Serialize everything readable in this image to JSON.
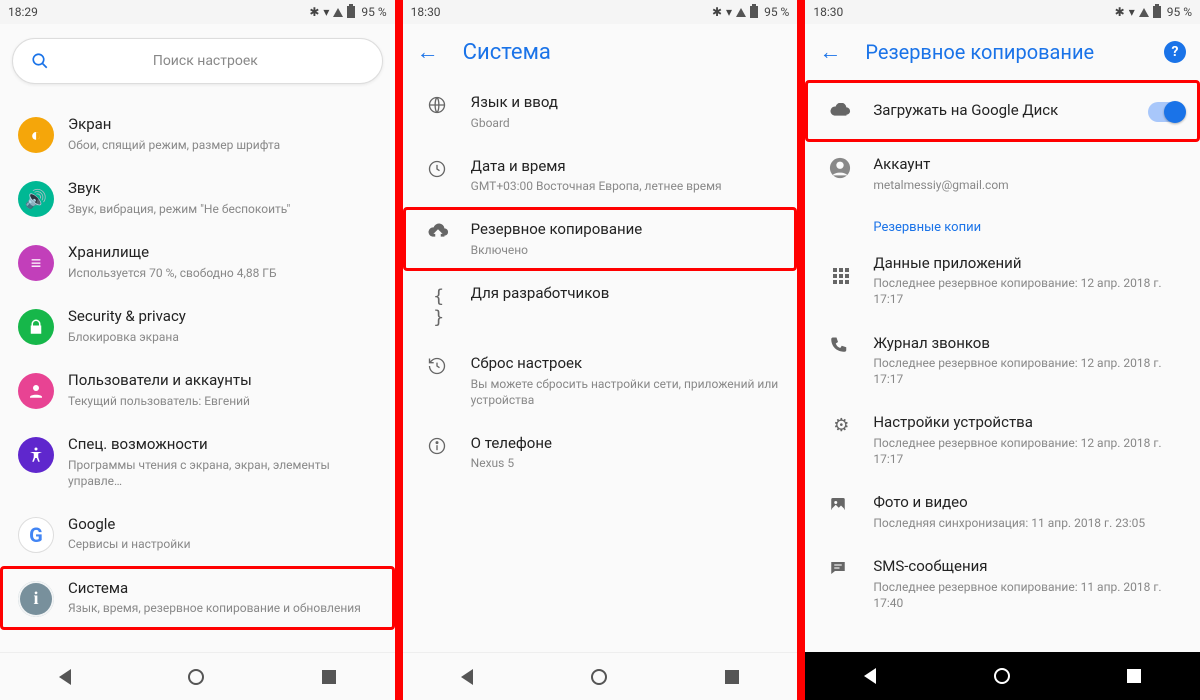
{
  "status": {
    "battery_text": "95 %"
  },
  "screen1": {
    "time": "18:29",
    "search_placeholder": "Поиск настроек",
    "items": [
      {
        "title": "Экран",
        "sub": "Обои, спящий режим, размер шрифта",
        "color": "#f5a60a"
      },
      {
        "title": "Звук",
        "sub": "Звук, вибрация, режим \"Не беспокоить\"",
        "color": "#00b894"
      },
      {
        "title": "Хранилище",
        "sub": "Используется 70 %, свободно 4,88 ГБ",
        "color": "#c23fba"
      },
      {
        "title": "Security & privacy",
        "sub": "Блокировка экрана",
        "color": "#16b74a"
      },
      {
        "title": "Пользователи и аккаунты",
        "sub": "Текущий пользователь: Евгений",
        "color": "#e84393"
      },
      {
        "title": "Спец. возможности",
        "sub": "Программы чтения с экрана, экран, элементы управле…",
        "color": "#5f27cd"
      },
      {
        "title": "Google",
        "sub": "Сервисы и настройки",
        "color": "#ffffff"
      },
      {
        "title": "Система",
        "sub": "Язык, время, резервное копирование и обновления",
        "color": "#78909c"
      }
    ]
  },
  "screen2": {
    "time": "18:30",
    "title": "Система",
    "items": [
      {
        "title": "Язык и ввод",
        "sub": "Gboard"
      },
      {
        "title": "Дата и время",
        "sub": "GMT+03:00 Восточная Европа, летнее время"
      },
      {
        "title": "Резервное копирование",
        "sub": "Включено"
      },
      {
        "title": "Для разработчиков",
        "sub": ""
      },
      {
        "title": "Сброс настроек",
        "sub": "Вы можете сбросить настройки сети, приложений или устройства"
      },
      {
        "title": "О телефоне",
        "sub": "Nexus 5"
      }
    ]
  },
  "screen3": {
    "time": "18:30",
    "title": "Резервное копирование",
    "upload": {
      "title": "Загружать на Google Диск"
    },
    "account": {
      "title": "Аккаунт",
      "sub": "metalmessiy@gmail.com"
    },
    "section_header": "Резервные копии",
    "items": [
      {
        "title": "Данные приложений",
        "sub": "Последнее резервное копирование: 12 апр. 2018 г. 17:17"
      },
      {
        "title": "Журнал звонков",
        "sub": "Последнее резервное копирование: 12 апр. 2018 г. 17:17"
      },
      {
        "title": "Настройки устройства",
        "sub": "Последнее резервное копирование: 12 апр. 2018 г. 17:17"
      },
      {
        "title": "Фото и видео",
        "sub": "Последняя синхронизация: 11 апр. 2018 г. 23:05"
      },
      {
        "title": "SMS-сообщения",
        "sub": "Последнее резервное копирование: 11 апр. 2018 г. 17:40"
      }
    ]
  }
}
